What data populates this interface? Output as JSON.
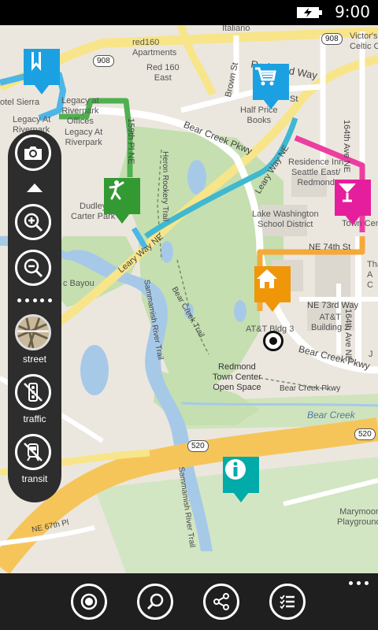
{
  "status_bar": {
    "time": "9:00",
    "battery_icon": "battery-charging-icon"
  },
  "map": {
    "labels": {
      "redmond_way": "Redmond Way",
      "bear_creek_pkwy_top": "Bear Creek Pkwy",
      "bear_creek_pkwy_bottom": "Bear Creek Pkwy",
      "bear_creek_pkwy_small": "Bear Creek Pkwy",
      "leary_way_1": "Leary Way NE",
      "leary_way_2": "Leary Way NE",
      "brown_st": "Brown St",
      "st_fragment": "St",
      "ave_164th_top": "164th Ave NE",
      "ave_164th_bottom": "164th Ave NE",
      "pl_159th": "159th Pl NE",
      "heron_rookery": "Heron Rookery Trail",
      "ne_74th": "NE 74th St",
      "ne_73rd": "NE 73rd Way",
      "ne_67th": "NE 67th Pl",
      "sammamish_trail_1": "Sammamish River Trail",
      "sammamish_trail_2": "Sammamish River Trail",
      "bear_creek_trail": "Bear Creek Trail",
      "bear_creek_water": "Bear Creek",
      "cc_bayou": "c Bayou",
      "red160": "red160\nApartments",
      "red160_east": "Red 160\nEast",
      "hotel_sierra": "otel Sierra",
      "legacy_offices": "Legacy at\nRiverpark\nOffices",
      "legacy_riverpark_1": "Legacy At\nRiverpark",
      "legacy_riverpark_2": "Legacy At\nRiverpark",
      "half_price_books": "Half Price\nBooks",
      "residence_inn": "Residence Inn\nSeattle East/\nRedmond",
      "victors": "Victor's\nCeltic C",
      "lake_washington": "Lake Washington\nSchool District",
      "town_center": "Town Cent",
      "dudley_carter": "Dudley\nCarter Park",
      "att_bldg3": "AT&T Bldg 3",
      "att_bldg2": "AT&T\nBuilding 2",
      "redmond_town_center": "Redmond\nTown Center\nOpen Space",
      "marymoor": "Marymoor\nPlayground",
      "route_908_1": "908",
      "route_908_2": "908",
      "route_520_1": "520",
      "route_520_2": "520",
      "right_fragments": "Tha\nA\nC",
      "j_fragment": "J",
      "top_fragment": "Italiano"
    },
    "pins": [
      {
        "name": "bookmark-pin",
        "icon": "bookmark-icon",
        "color": "#1ba1e2"
      },
      {
        "name": "shopping-pin",
        "icon": "shopping-cart-icon",
        "color": "#1ba1e2"
      },
      {
        "name": "golf-pin",
        "icon": "golf-icon",
        "color": "#339933"
      },
      {
        "name": "bar-pin",
        "icon": "cocktail-icon",
        "color": "#e51e9d"
      },
      {
        "name": "home-pin",
        "icon": "home-icon",
        "color": "#f09609"
      },
      {
        "name": "info-pin",
        "icon": "info-icon",
        "color": "#00aba9"
      }
    ]
  },
  "sidebar": {
    "camera": "camera-icon",
    "zoom_in": "zoom-in-icon",
    "zoom_out": "zoom-out-icon",
    "street_label": "street",
    "traffic_label": "traffic",
    "transit_label": "transit"
  },
  "appbar": {
    "buttons": [
      "locate-icon",
      "search-icon",
      "share-icon",
      "list-icon"
    ],
    "more": "more-icon"
  }
}
